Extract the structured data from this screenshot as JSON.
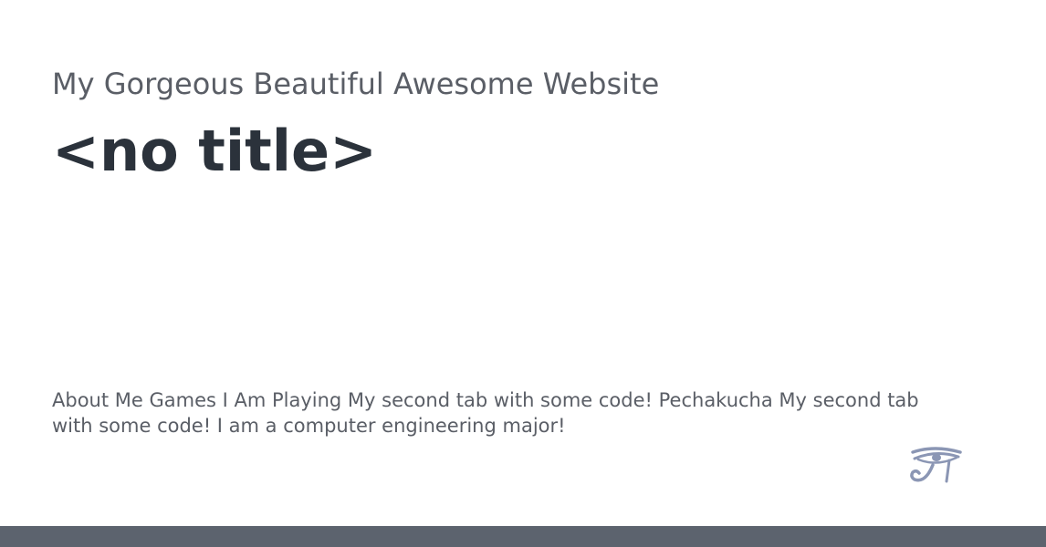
{
  "header": {
    "site_name": "My Gorgeous Beautiful Awesome Website",
    "page_title": "<no title>"
  },
  "main": {
    "description": "About Me Games I Am Playing My second tab with some code! Pechakucha My second tab with some code! I am a computer engineering major!"
  },
  "logo": {
    "icon": "eye-of-horus-icon"
  },
  "colors": {
    "background": "#ffffff",
    "site_name": "#5a5e66",
    "page_title": "#2b323b",
    "description": "#5a5e66",
    "logo": "#8b96b4",
    "footer_bar": "#5c636e"
  }
}
